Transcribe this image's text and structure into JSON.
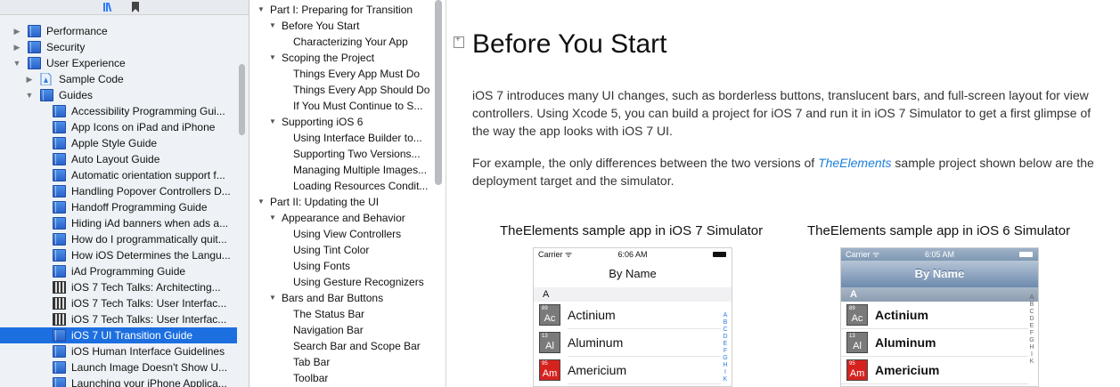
{
  "library": {
    "items": [
      {
        "label": "Performance",
        "indent": 1,
        "disclosure": "▶",
        "icon": "book",
        "selected": false
      },
      {
        "label": "Security",
        "indent": 1,
        "disclosure": "▶",
        "icon": "book",
        "selected": false
      },
      {
        "label": "User Experience",
        "indent": 1,
        "disclosure": "▼",
        "icon": "book",
        "selected": false
      },
      {
        "label": "Sample Code",
        "indent": 2,
        "disclosure": "▶",
        "icon": "sample",
        "selected": false
      },
      {
        "label": "Guides",
        "indent": 2,
        "disclosure": "▼",
        "icon": "book",
        "selected": false
      },
      {
        "label": "Accessibility Programming Gui...",
        "indent": 3,
        "disclosure": "",
        "icon": "book",
        "selected": false
      },
      {
        "label": "App Icons on iPad and iPhone",
        "indent": 3,
        "disclosure": "",
        "icon": "book",
        "selected": false
      },
      {
        "label": "Apple Style Guide",
        "indent": 3,
        "disclosure": "",
        "icon": "book",
        "selected": false
      },
      {
        "label": "Auto Layout Guide",
        "indent": 3,
        "disclosure": "",
        "icon": "book",
        "selected": false
      },
      {
        "label": "Automatic orientation support f...",
        "indent": 3,
        "disclosure": "",
        "icon": "book",
        "selected": false
      },
      {
        "label": "Handling Popover Controllers D...",
        "indent": 3,
        "disclosure": "",
        "icon": "book",
        "selected": false
      },
      {
        "label": "Handoff Programming Guide",
        "indent": 3,
        "disclosure": "",
        "icon": "book",
        "selected": false
      },
      {
        "label": "Hiding iAd banners when ads a...",
        "indent": 3,
        "disclosure": "",
        "icon": "book",
        "selected": false
      },
      {
        "label": "How do I programmatically quit...",
        "indent": 3,
        "disclosure": "",
        "icon": "book",
        "selected": false
      },
      {
        "label": "How iOS Determines the Langu...",
        "indent": 3,
        "disclosure": "",
        "icon": "book",
        "selected": false
      },
      {
        "label": "iAd Programming Guide",
        "indent": 3,
        "disclosure": "",
        "icon": "book",
        "selected": false
      },
      {
        "label": "iOS 7 Tech Talks: Architecting...",
        "indent": 3,
        "disclosure": "",
        "icon": "video",
        "selected": false
      },
      {
        "label": "iOS 7 Tech Talks: User Interfac...",
        "indent": 3,
        "disclosure": "",
        "icon": "video",
        "selected": false
      },
      {
        "label": "iOS 7 Tech Talks: User Interfac...",
        "indent": 3,
        "disclosure": "",
        "icon": "video",
        "selected": false
      },
      {
        "label": "iOS 7 UI Transition Guide",
        "indent": 3,
        "disclosure": "",
        "icon": "book",
        "selected": true
      },
      {
        "label": "iOS Human Interface Guidelines",
        "indent": 3,
        "disclosure": "",
        "icon": "book",
        "selected": false
      },
      {
        "label": "Launch Image Doesn't Show U...",
        "indent": 3,
        "disclosure": "",
        "icon": "book",
        "selected": false
      },
      {
        "label": "Launching your iPhone Applica...",
        "indent": 3,
        "disclosure": "",
        "icon": "book",
        "selected": false
      }
    ]
  },
  "toc": {
    "items": [
      {
        "label": "Part I: Preparing for Transition",
        "level": 0,
        "disclosure": "▼"
      },
      {
        "label": "Before You Start",
        "level": 1,
        "disclosure": "▼"
      },
      {
        "label": "Characterizing Your App",
        "level": 2,
        "disclosure": ""
      },
      {
        "label": "Scoping the Project",
        "level": 1,
        "disclosure": "▼"
      },
      {
        "label": "Things Every App Must Do",
        "level": 2,
        "disclosure": ""
      },
      {
        "label": "Things Every App Should Do",
        "level": 2,
        "disclosure": ""
      },
      {
        "label": "If You Must Continue to S...",
        "level": 2,
        "disclosure": ""
      },
      {
        "label": "Supporting iOS 6",
        "level": 1,
        "disclosure": "▼"
      },
      {
        "label": "Using Interface Builder to...",
        "level": 2,
        "disclosure": ""
      },
      {
        "label": "Supporting Two Versions...",
        "level": 2,
        "disclosure": ""
      },
      {
        "label": "Managing Multiple Images...",
        "level": 2,
        "disclosure": ""
      },
      {
        "label": "Loading Resources Condit...",
        "level": 2,
        "disclosure": ""
      },
      {
        "label": "Part II: Updating the UI",
        "level": 0,
        "disclosure": "▼"
      },
      {
        "label": "Appearance and Behavior",
        "level": 1,
        "disclosure": "▼"
      },
      {
        "label": "Using View Controllers",
        "level": 2,
        "disclosure": ""
      },
      {
        "label": "Using Tint Color",
        "level": 2,
        "disclosure": ""
      },
      {
        "label": "Using Fonts",
        "level": 2,
        "disclosure": ""
      },
      {
        "label": "Using Gesture Recognizers",
        "level": 2,
        "disclosure": ""
      },
      {
        "label": "Bars and Bar Buttons",
        "level": 1,
        "disclosure": "▼"
      },
      {
        "label": "The Status Bar",
        "level": 2,
        "disclosure": ""
      },
      {
        "label": "Navigation Bar",
        "level": 2,
        "disclosure": ""
      },
      {
        "label": "Search Bar and Scope Bar",
        "level": 2,
        "disclosure": ""
      },
      {
        "label": "Tab Bar",
        "level": 2,
        "disclosure": ""
      },
      {
        "label": "Toolbar",
        "level": 2,
        "disclosure": ""
      }
    ]
  },
  "content": {
    "title": "Before You Start",
    "para1": "iOS 7 introduces many UI changes, such as borderless buttons, translucent bars, and full-screen layout for view controllers. Using Xcode 5, you can build a project for iOS 7 and run it in iOS 7 Simulator to get a first glimpse of the way the app looks with iOS 7 UI.",
    "para2_before": "For example, the only differences between the two versions of ",
    "para2_link": "TheElements",
    "para2_after": " sample project shown below are the deployment target and the simulator.",
    "figures": [
      {
        "caption": "TheElements sample app in iOS 7 Simulator",
        "carrier": "Carrier ᯤ",
        "time": "6:06 AM",
        "nav_title": "By Name",
        "section": "A",
        "index_letters": [
          "A",
          "B",
          "C",
          "D",
          "E",
          "F",
          "G",
          "H",
          "I",
          "K"
        ],
        "elements": [
          {
            "num": "89",
            "sym": "Ac",
            "name": "Actinium",
            "color": "#7a7a7a"
          },
          {
            "num": "13",
            "sym": "Al",
            "name": "Aluminum",
            "color": "#7a7a7a"
          },
          {
            "num": "95",
            "sym": "Am",
            "name": "Americium",
            "color": "#d6221f"
          }
        ]
      },
      {
        "caption": "TheElements sample app in iOS 6 Simulator",
        "carrier": "Carrier ᯤ",
        "time": "6:05 AM",
        "nav_title": "By Name",
        "section": "A",
        "index_letters": [
          "A",
          "B",
          "C",
          "D",
          "E",
          "F",
          "G",
          "H",
          "I",
          "K"
        ],
        "elements": [
          {
            "num": "89",
            "sym": "Ac",
            "name": "Actinium",
            "color": "#7a7a7a"
          },
          {
            "num": "13",
            "sym": "Al",
            "name": "Aluminum",
            "color": "#7a7a7a"
          },
          {
            "num": "95",
            "sym": "Am",
            "name": "Americium",
            "color": "#d6221f"
          }
        ]
      }
    ]
  },
  "colors": {
    "selection": "#1d6fe0",
    "link": "#1c7ed9",
    "toolbar_icon": "#2f7cf6"
  }
}
